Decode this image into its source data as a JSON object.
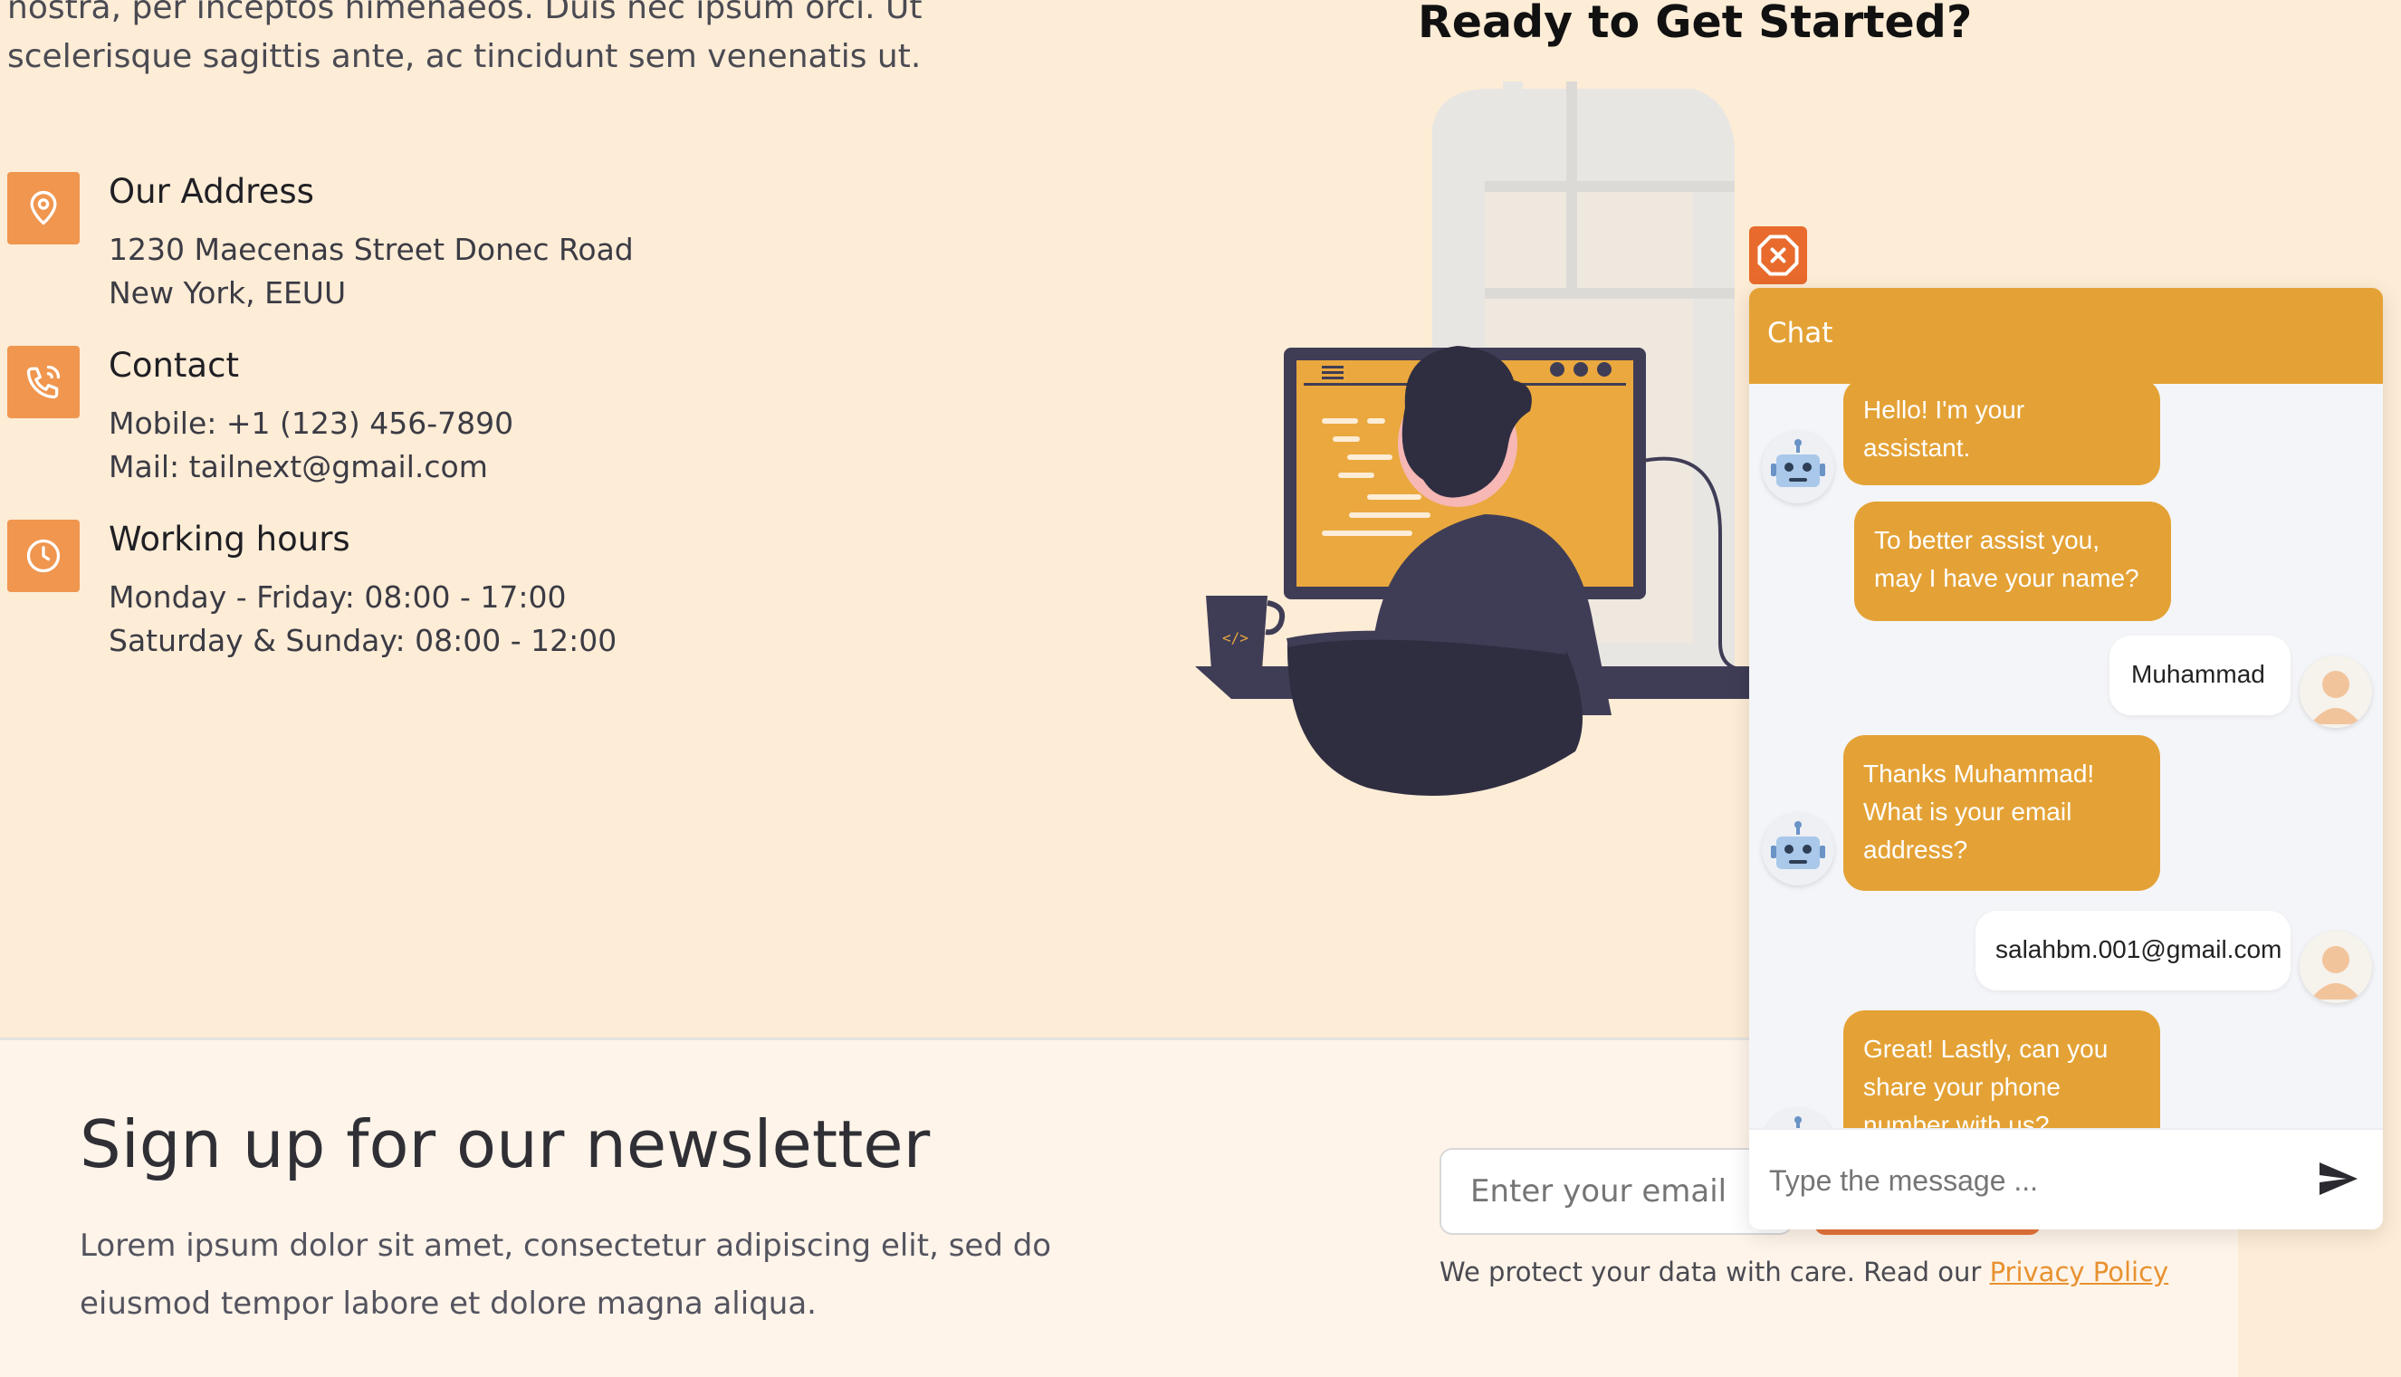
{
  "intro": {
    "text_line1": "nostra, per inceptos himenaeos. Duis nec ipsum orci. Ut",
    "text_line2": "scelerisque sagittis ante, ac tincidunt sem venenatis ut."
  },
  "contact_info": [
    {
      "icon": "map-pin-icon",
      "title": "Our Address",
      "lines": [
        "1230 Maecenas Street Donec Road",
        "New York, EEUU"
      ]
    },
    {
      "icon": "phone-icon",
      "title": "Contact",
      "lines": [
        "Mobile: +1 (123) 456-7890",
        "Mail: tailnext@gmail.com"
      ]
    },
    {
      "icon": "clock-icon",
      "title": "Working hours",
      "lines": [
        "Monday - Friday: 08:00 - 17:00",
        "Saturday & Sunday: 08:00 - 12:00"
      ]
    }
  ],
  "hero": {
    "title": "Ready to Get Started?"
  },
  "newsletter": {
    "title": "Sign up for our newsletter",
    "description": "Lorem ipsum dolor sit amet, consectetur adipiscing elit, sed do eiusmod tempor labore et dolore magna aliqua.",
    "email_placeholder": "Enter your email",
    "privacy_text": "We protect your data with care. Read our ",
    "privacy_link": "Privacy Policy"
  },
  "chat": {
    "header_title": "Chat",
    "input_placeholder": "Type the message ...",
    "messages": [
      {
        "from": "bot",
        "lines": [
          "Hello! I'm your",
          "assistant."
        ]
      },
      {
        "from": "bot",
        "lines": [
          "To better assist you,",
          "may I have your name?"
        ]
      },
      {
        "from": "user",
        "text": "Muhammad"
      },
      {
        "from": "bot",
        "lines": [
          "Thanks Muhammad!",
          "What is your email",
          "address?"
        ]
      },
      {
        "from": "user",
        "text": "salahbm.001@gmail.com"
      },
      {
        "from": "bot",
        "lines": [
          "Great! Lastly, can you",
          "share your phone",
          "number with us?"
        ]
      }
    ]
  },
  "colors": {
    "page_background": "#fdecd6",
    "accent_orange": "#f0964f",
    "chat_accent": "#e4a236",
    "close_button": "#e86a2c",
    "link": "#e89130"
  }
}
